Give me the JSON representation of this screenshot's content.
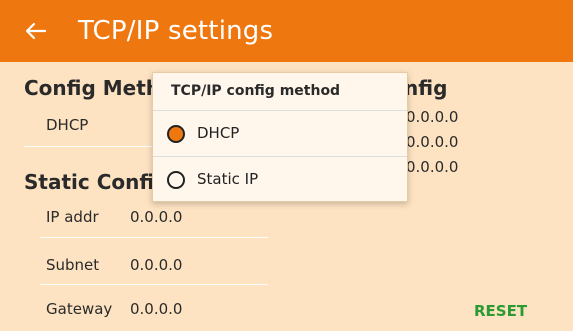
{
  "appbar": {
    "title": "TCP/IP settings"
  },
  "config": {
    "heading": "Config Meth",
    "dhcp_label": "DHCP"
  },
  "current": {
    "heading": "nfig",
    "values": [
      "0.0.0.0",
      "0.0.0.0",
      "0.0.0.0"
    ]
  },
  "static": {
    "heading": "Static Config",
    "rows": [
      {
        "label": "IP addr",
        "value": "0.0.0.0"
      },
      {
        "label": "Subnet",
        "value": "0.0.0.0"
      },
      {
        "label": "Gateway",
        "value": "0.0.0.0"
      }
    ]
  },
  "actions": {
    "reset_label": "RESET"
  },
  "dialog": {
    "title": "TCP/IP config method",
    "options": [
      {
        "label": "DHCP",
        "selected": true
      },
      {
        "label": "Static IP",
        "selected": false
      }
    ]
  },
  "colors": {
    "accent": "#ef770f",
    "background": "#fde3c2",
    "reset": "#2b9a33"
  },
  "icons": {
    "back": "arrow-left-icon"
  }
}
